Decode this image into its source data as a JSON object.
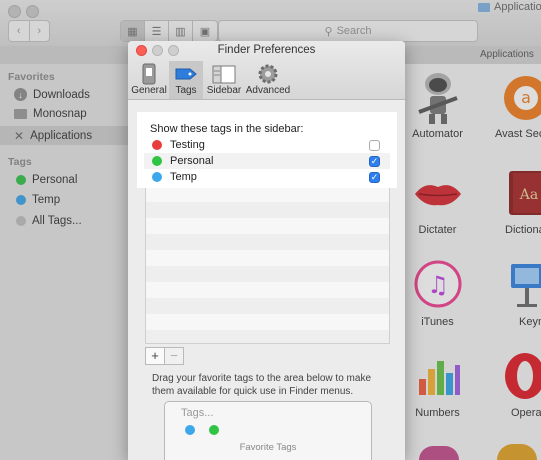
{
  "finder": {
    "search_placeholder": "Search",
    "title": "Applications",
    "path_label": "Applications",
    "sidebar": {
      "favorites_header": "Favorites",
      "favorites": [
        {
          "label": "Downloads"
        },
        {
          "label": "Monosnap"
        },
        {
          "label": "Applications"
        }
      ],
      "tags_header": "Tags",
      "tags": [
        {
          "label": "Personal",
          "color": "#2fbf4a"
        },
        {
          "label": "Temp",
          "color": "#3aa0e8"
        },
        {
          "label": "All Tags..."
        }
      ]
    },
    "apps": [
      {
        "label": "Automator"
      },
      {
        "label": "Avast Sec"
      },
      {
        "label": "Dictater"
      },
      {
        "label": "Dictiona"
      },
      {
        "label": "iTunes"
      },
      {
        "label": "Keynot"
      },
      {
        "label": "Numbers"
      },
      {
        "label": "Opera"
      }
    ]
  },
  "prefs": {
    "window_title": "Finder Preferences",
    "tabs": [
      {
        "label": "General"
      },
      {
        "label": "Tags"
      },
      {
        "label": "Sidebar"
      },
      {
        "label": "Advanced"
      }
    ],
    "selected_tab": "Tags",
    "heading": "Show these tags in the sidebar:",
    "tags": [
      {
        "label": "Testing",
        "color": "#e83d3d",
        "checked": false
      },
      {
        "label": "Personal",
        "color": "#2fc443",
        "checked": true
      },
      {
        "label": "Temp",
        "color": "#3aa8ea",
        "checked": true
      }
    ],
    "add_label": "+",
    "remove_label": "−",
    "instructions": "Drag your favorite tags to the area below to make them available for quick use in Finder menus.",
    "favorites_box": {
      "placeholder": "Tags...",
      "label": "Favorite Tags",
      "dots": [
        "#3aa8ea",
        "#2fc443"
      ]
    }
  }
}
